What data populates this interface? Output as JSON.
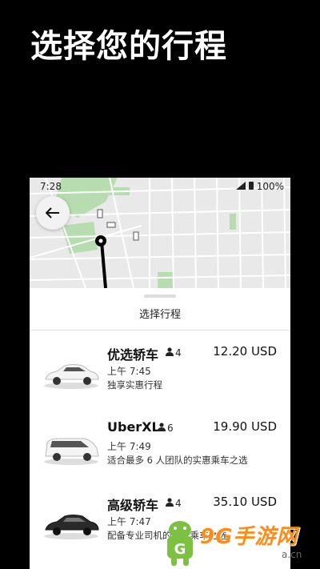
{
  "headline": "选择您的行程",
  "status": {
    "time": "7:28",
    "battery": "100%"
  },
  "sheet": {
    "title": "选择行程"
  },
  "rides": [
    {
      "name": "优选轿车",
      "capacity": "4",
      "price": "12.20 USD",
      "time": "上午 7:45",
      "desc": "独享实惠行程",
      "car_color": "white-sedan"
    },
    {
      "name": "UberXL",
      "capacity": "6",
      "price": "19.90 USD",
      "time": "上午 7:49",
      "desc": "适合最多 6 人团队的实惠乘车之选",
      "car_color": "white-van"
    },
    {
      "name": "高级轿车",
      "capacity": "4",
      "price": "35.10 USD",
      "time": "上午 7:47",
      "desc": "配备专业司机的豪华乘车之选",
      "car_color": "black-sedan"
    }
  ],
  "watermark": {
    "text": "9G手游网",
    "domain": "a.cn"
  },
  "colors": {
    "background": "#000000",
    "map": "#e9e9e9",
    "park": "#a8d5a2",
    "accent_orange": "#ff8c1a"
  }
}
